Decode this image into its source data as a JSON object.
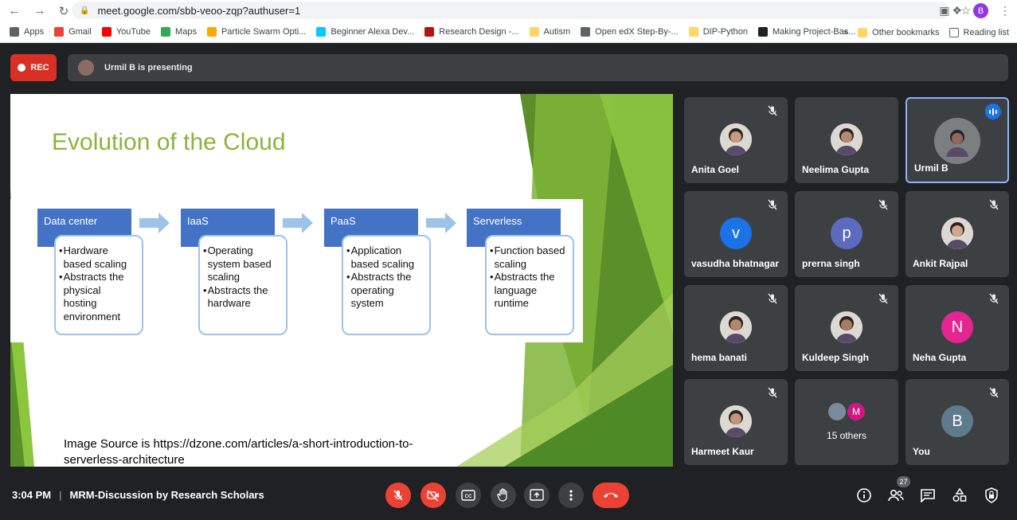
{
  "browser": {
    "url": "meet.google.com/sbb-veoo-zqp?authuser=1",
    "profile_initial": "B",
    "bookmarks": [
      {
        "label": "Apps",
        "icon": "apps-grid-icon",
        "color": "#5f6368"
      },
      {
        "label": "Gmail",
        "icon": "gmail-icon",
        "color": "#ea4335"
      },
      {
        "label": "YouTube",
        "icon": "youtube-icon",
        "color": "#ff0000"
      },
      {
        "label": "Maps",
        "icon": "maps-icon",
        "color": "#34a853"
      },
      {
        "label": "Particle Swarm Opti...",
        "icon": "flame-icon",
        "color": "#f9ab00"
      },
      {
        "label": "Beginner Alexa Dev...",
        "icon": "alexa-icon",
        "color": "#00caff"
      },
      {
        "label": "Research Design -...",
        "icon": "site-icon",
        "color": "#b31412"
      },
      {
        "label": "Autism",
        "icon": "folder-icon",
        "color": "#fdd663"
      },
      {
        "label": "Open edX Step-By-...",
        "icon": "site-icon",
        "color": "#5f6368"
      },
      {
        "label": "DIP-Python",
        "icon": "folder-icon",
        "color": "#fdd663"
      },
      {
        "label": "Making Project-Bas...",
        "icon": "hb-icon",
        "color": "#202124"
      }
    ],
    "other_bookmarks": "Other bookmarks",
    "reading_list": "Reading list",
    "overflow": "»"
  },
  "meet": {
    "rec_label": "REC",
    "presenting_text": "Urmil B is presenting",
    "time": "3:04 PM",
    "meeting_name": "MRM-Discussion by Research Scholars",
    "participant_count": "27"
  },
  "slide": {
    "title": "Evolution of the Cloud",
    "stages": [
      {
        "head": "Data center",
        "bullets": [
          "Hardware based scaling",
          "Abstracts the physical hosting environment"
        ]
      },
      {
        "head": "IaaS",
        "bullets": [
          "Operating system based scaling",
          "Abstracts the hardware"
        ]
      },
      {
        "head": "PaaS",
        "bullets": [
          "Application based scaling",
          "Abstracts the operating system"
        ]
      },
      {
        "head": "Serverless",
        "bullets": [
          "Function based scaling",
          "Abstracts the language runtime"
        ]
      }
    ],
    "source_line1": "Image Source is https://dzone.com/articles/a-short-introduction-to-",
    "source_line2": "serverless-architecture",
    "colors": {
      "title": "#8db33c",
      "stage_head": "#4472c4",
      "stage_border": "#9dc3e6"
    }
  },
  "participants": [
    {
      "name": "Anita Goel",
      "avatar": "photo",
      "muted": true
    },
    {
      "name": "Neelima Gupta",
      "avatar": "photo",
      "muted": false
    },
    {
      "name": "Urmil B",
      "avatar": "photo",
      "muted": false,
      "speaking": true
    },
    {
      "name": "vasudha bhatnagar",
      "avatar": "v",
      "avatar_color": "#1a73e8",
      "muted": true
    },
    {
      "name": "prerna singh",
      "avatar": "p",
      "avatar_color": "#5c6bc0",
      "muted": true
    },
    {
      "name": "Ankit Rajpal",
      "avatar": "photo",
      "muted": true
    },
    {
      "name": "hema banati",
      "avatar": "photo",
      "muted": true
    },
    {
      "name": "Kuldeep Singh",
      "avatar": "photo",
      "muted": true
    },
    {
      "name": "Neha Gupta",
      "avatar": "N",
      "avatar_color": "#e52592",
      "muted": true
    },
    {
      "name": "Harmeet Kaur",
      "avatar": "photo",
      "muted": true
    },
    {
      "name": "15 others",
      "avatar": "group",
      "group_initial": "M",
      "muted": false
    },
    {
      "name": "You",
      "avatar": "B",
      "avatar_color": "#5f7a8a",
      "muted": true
    }
  ]
}
